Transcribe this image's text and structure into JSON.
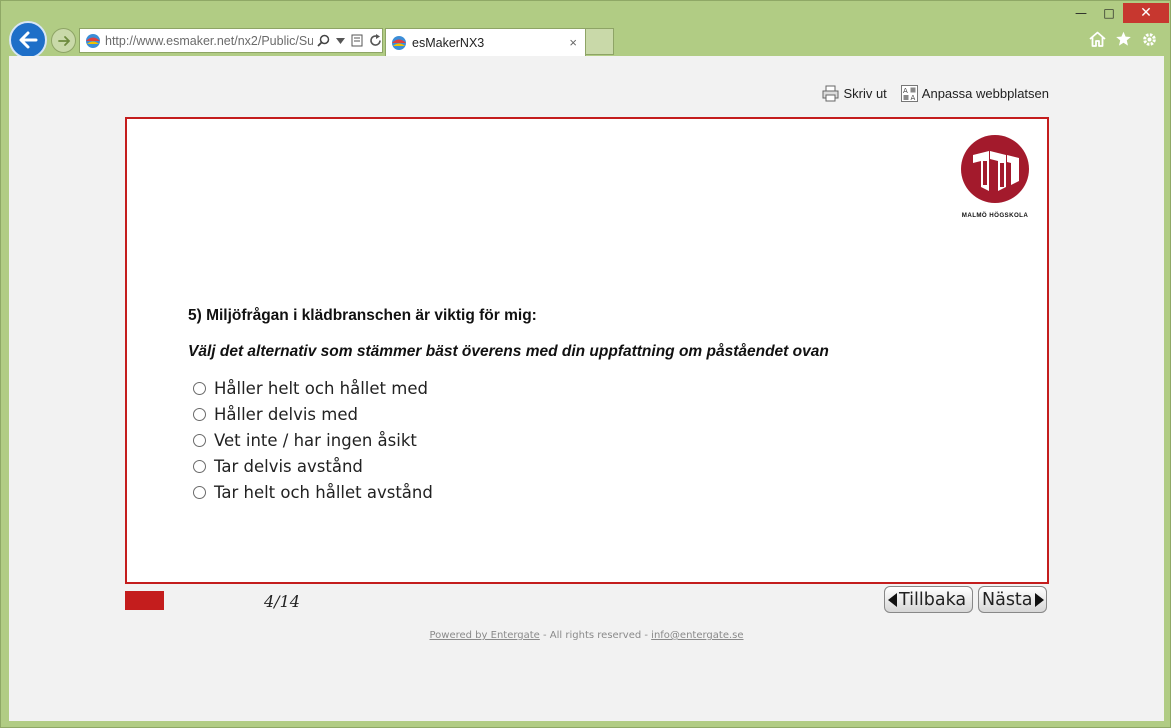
{
  "browser": {
    "url": "http://www.esmaker.net/nx2/Public/Su",
    "tab_title": "esMakerNX3",
    "tab_close": "×",
    "window_controls": [
      "minimize-icon",
      "maximize-icon",
      "close-icon"
    ],
    "commands": [
      "home-icon",
      "favorites-icon",
      "tools-icon"
    ]
  },
  "toolbar": {
    "print_label": "Skriv ut",
    "customize_label": "Anpassa webbplatsen"
  },
  "logo": {
    "text": "MALMÖ HÖGSKOLA",
    "color": "#a31a2c"
  },
  "survey": {
    "question": "5) Miljöfrågan i klädbranschen är viktig för mig:",
    "instruction": "Välj det alternativ som stämmer bäst överens med din uppfattning om påståendet ovan",
    "options": [
      "Håller helt och hållet med",
      "Håller delvis med",
      "Vet inte / har ingen åsikt",
      "Tar delvis avstånd",
      "Tar helt och hållet avstånd"
    ],
    "selected": null
  },
  "progress": {
    "page": "4/14",
    "current": 4,
    "total": 14,
    "color": "#c41d1d"
  },
  "nav": {
    "prev_label": "Tillbaka",
    "next_label": "Nästa"
  },
  "footer": {
    "powered": "Powered by Entergate",
    "rights": " - All rights reserved - ",
    "email": "info@entergate.se"
  },
  "colors": {
    "frame": "#b1cc84",
    "accent": "#c41d1d"
  }
}
